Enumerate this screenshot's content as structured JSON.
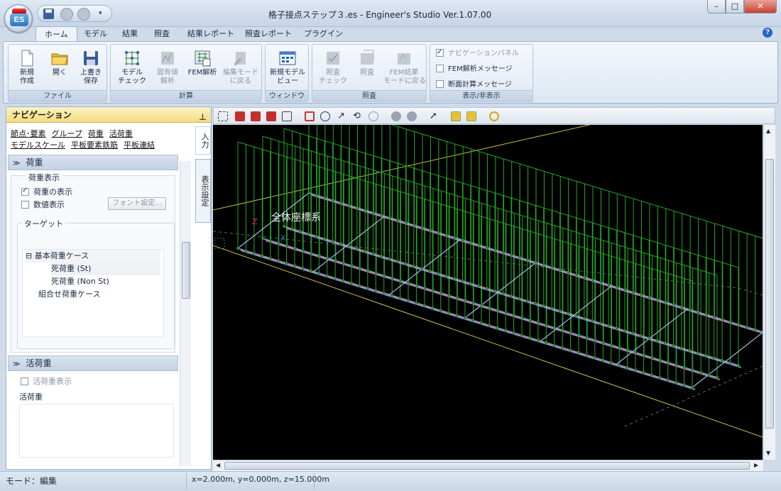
{
  "window": {
    "title": "格子接点ステップ３.es - Engineer's Studio Ver.1.07.00",
    "logo_text": "ES",
    "min": "–",
    "max": "□",
    "close": "✕"
  },
  "tabs": [
    "ホーム",
    "モデル",
    "結果",
    "照査",
    "結果レポート",
    "照査レポート",
    "プラグイン"
  ],
  "help": "?",
  "ribbon": {
    "file": {
      "label": "ファイル",
      "new": "新規\n作成",
      "open": "開く",
      "save": "上書き\n保存"
    },
    "calc": {
      "label": "計算",
      "model_check": "モデル\nチェック",
      "eigen": "固有値\n解析",
      "fem": "FEM解析",
      "edit_mode": "編集モード\nに戻る"
    },
    "window": {
      "label": "ウィンドウ",
      "new_view": "新規モデル\nビュー"
    },
    "check": {
      "label": "照査",
      "check_check": "照査\nチェック",
      "check": "照査",
      "fem_back": "FEM結果\nモードに戻る"
    },
    "display": {
      "label": "表示/非表示",
      "nav_panel": "ナビゲーションパネル",
      "fem_msg": "FEM解析メッセージ",
      "section_msg": "断面計算メッセージ"
    }
  },
  "nav": {
    "title": "ナビゲーション",
    "pin": "ꟷ",
    "side_tabs": {
      "input": "入力",
      "display": "表示設定"
    },
    "links_row1": [
      "節点･要素",
      "グループ",
      "荷重",
      "活荷重"
    ],
    "links_row2": [
      "モデルスケール",
      "平板要素鉄筋",
      "平板連結"
    ],
    "load_section": "荷重",
    "load_display": "荷重表示",
    "show_load": "荷重の表示",
    "show_value": "数値表示",
    "font_btn": "フォント設定...",
    "target": "ターゲット",
    "tree": {
      "root": "基本荷重ケース",
      "c1": "死荷重 (St)",
      "c2": "死荷重 (Non St)",
      "combo": "組合せ荷重ケース"
    },
    "live_section": "活荷重",
    "live_show": "活荷重表示",
    "live_label": "活荷重",
    "chev": "≫"
  },
  "viewport": {
    "label": "全体座標系",
    "axis_z": "Z",
    "axis_x": "X"
  },
  "status": {
    "mode": "モード：編集",
    "coords": "x=2.000m, y=0.000m, z=15.000m"
  }
}
